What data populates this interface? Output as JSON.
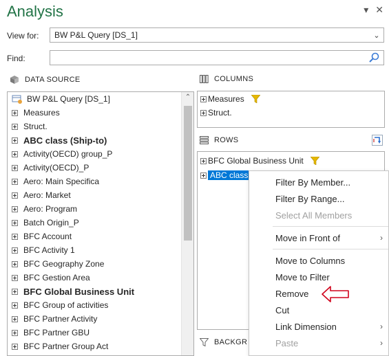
{
  "panel": {
    "title": "Analysis"
  },
  "view_for": {
    "label": "View for:",
    "value": "BW P&L Query [DS_1]"
  },
  "find": {
    "label": "Find:",
    "value": "",
    "placeholder": ""
  },
  "data_source": {
    "header": "DATA SOURCE",
    "root": "BW P&L Query [DS_1]",
    "items": [
      {
        "label": "Measures",
        "bold": false
      },
      {
        "label": "Struct.",
        "bold": false
      },
      {
        "label": "ABC class (Ship-to)",
        "bold": true
      },
      {
        "label": "Activity(OECD) group_P",
        "bold": false
      },
      {
        "label": "Activity(OECD)_P",
        "bold": false
      },
      {
        "label": "Aero: Main Specifica",
        "bold": false
      },
      {
        "label": "Aero: Market",
        "bold": false
      },
      {
        "label": "Aero: Program",
        "bold": false
      },
      {
        "label": "Batch Origin_P",
        "bold": false
      },
      {
        "label": "BFC Account",
        "bold": false
      },
      {
        "label": "BFC Activity 1",
        "bold": false
      },
      {
        "label": "BFC Geography Zone",
        "bold": false
      },
      {
        "label": "BFC Gestion Area",
        "bold": false
      },
      {
        "label": "BFC Global Business Unit",
        "bold": true
      },
      {
        "label": "BFC Group of activities",
        "bold": false
      },
      {
        "label": "BFC Partner Activity",
        "bold": false
      },
      {
        "label": "BFC Partner GBU",
        "bold": false
      },
      {
        "label": "BFC Partner Group Act",
        "bold": false
      }
    ]
  },
  "columns": {
    "header": "COLUMNS",
    "items": [
      "Measures",
      "Struct."
    ]
  },
  "rows": {
    "header": "ROWS",
    "items": [
      "BFC Global Business Unit",
      "ABC class"
    ]
  },
  "background": {
    "header": "BACKGR"
  },
  "context_menu": {
    "items": [
      {
        "label": "Filter By Member...",
        "disabled": false,
        "submenu": false
      },
      {
        "label": "Filter By Range...",
        "disabled": false,
        "submenu": false
      },
      {
        "label": "Select All Members",
        "disabled": true,
        "submenu": false
      },
      {
        "label": "Move in Front of",
        "disabled": false,
        "submenu": true
      },
      {
        "label": "Move to Columns",
        "disabled": false,
        "submenu": false
      },
      {
        "label": "Move to Filter",
        "disabled": false,
        "submenu": false
      },
      {
        "label": "Remove",
        "disabled": false,
        "submenu": false
      },
      {
        "label": "Cut",
        "disabled": false,
        "submenu": false
      },
      {
        "label": "Link Dimension",
        "disabled": false,
        "submenu": true
      },
      {
        "label": "Paste",
        "disabled": true,
        "submenu": true
      }
    ]
  },
  "colors": {
    "title": "#217346",
    "selection": "#0078d7",
    "filter_icon": "#e6b800",
    "annotation_arrow": "#d0021b"
  },
  "icons": {
    "dropdown": "chevron-down-icon",
    "search": "search-icon",
    "close": "close-icon",
    "data_source": "cube-icon",
    "columns": "columns-icon",
    "rows": "rows-icon",
    "filter": "filter-icon",
    "swap": "swap-axes-icon",
    "background": "funnel-outline-icon"
  }
}
